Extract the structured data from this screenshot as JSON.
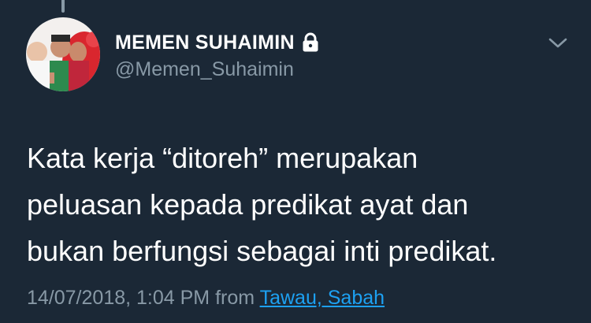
{
  "user": {
    "display_name": "MEMEN SUHAIMIN",
    "handle": "@Memen_Suhaimin",
    "protected_icon": "lock-icon",
    "avatar_icon": "profile-photo"
  },
  "tweet": {
    "lines": [
      "Kata kerja “ditoreh” merupakan",
      "peluasan kepada predikat ayat dan",
      "bukan berfungsi sebagai inti predikat."
    ],
    "timestamp": "14/07/2018, 1:04 PM",
    "from_label": "from",
    "location": "Tawau, Sabah"
  },
  "menu_icon": "chevron-down-icon",
  "colors": {
    "background": "#1b2836",
    "text": "#ffffff",
    "secondary_text": "#8899a6",
    "link": "#1da1f2"
  }
}
